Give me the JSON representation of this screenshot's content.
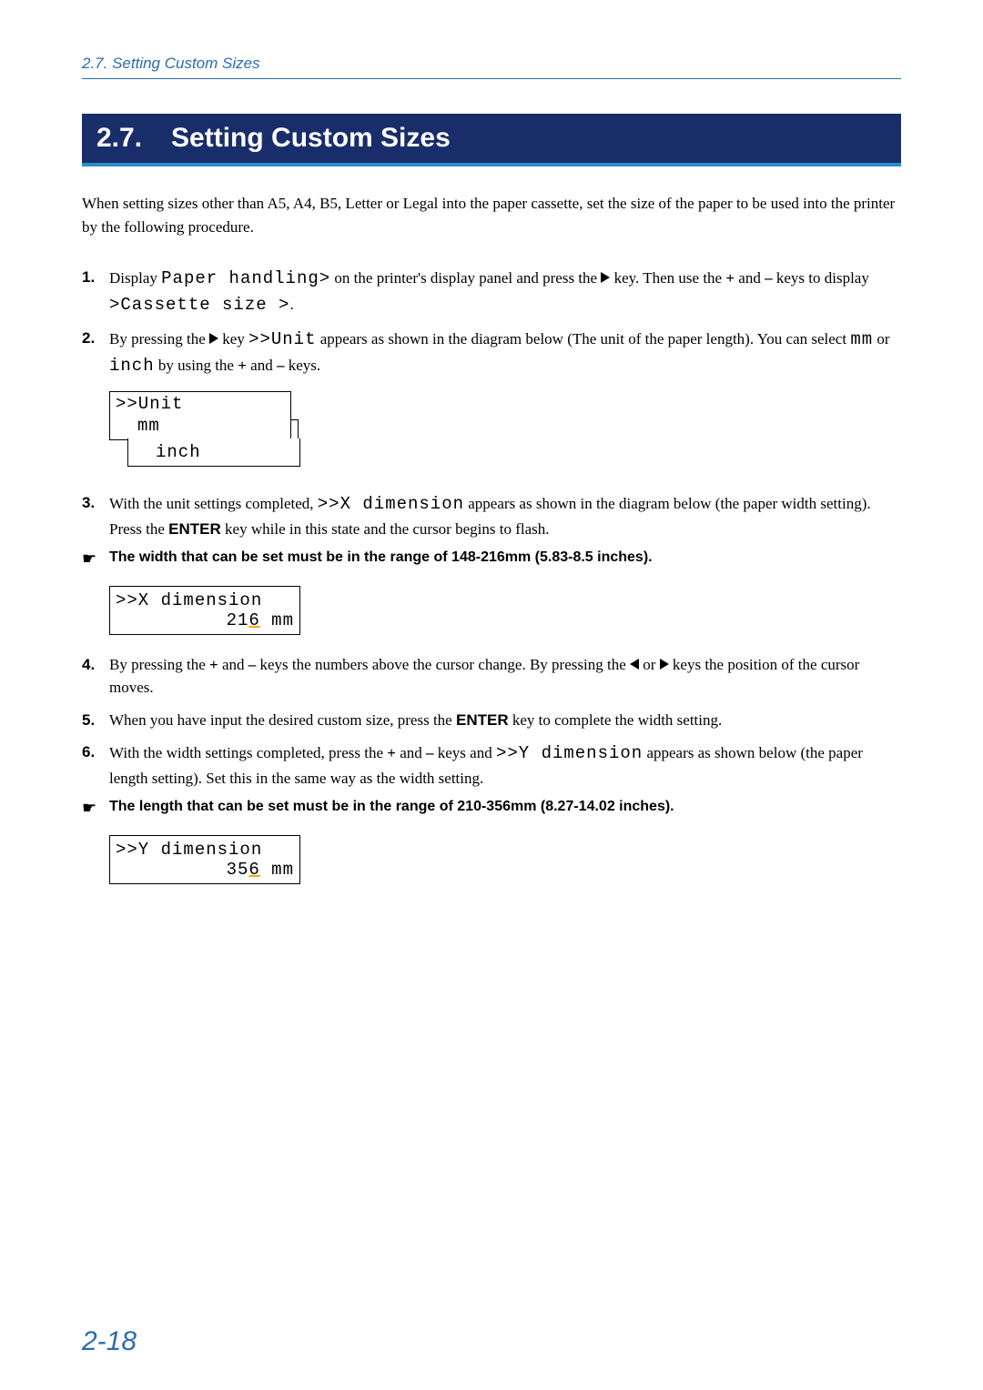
{
  "header": {
    "breadcrumb": "2.7. Setting Custom Sizes"
  },
  "title": {
    "num": "2.7.",
    "text": "Setting Custom Sizes"
  },
  "intro": "When setting sizes other than A5, A4, B5, Letter or Legal into the paper cassette, set the size of the paper to be used into the printer by the following procedure.",
  "steps": {
    "s1": {
      "num": "1.",
      "pre": "Display ",
      "lcd1": "Paper handling>",
      "mid": " on the printer's display panel and press the ",
      "mid2": " key. Then use the ",
      "plus": "+",
      "and1": " and ",
      "minus": "–",
      "post": " keys to display ",
      "lcd2": ">Cassette size >",
      "end": "."
    },
    "s2": {
      "num": "2.",
      "pre": "By pressing the ",
      "mid": " key ",
      "lcd1": ">>Unit",
      "mid2": " appears as shown in the diagram below (The unit of the paper length). You can select ",
      "lcd2": "mm",
      "or": " or ",
      "lcd3": "inch",
      "post": " by using the ",
      "plus": "+",
      "and1": " and ",
      "minus": "–",
      "end": " keys."
    },
    "s3": {
      "num": "3.",
      "pre": "With the unit settings completed, ",
      "lcd1": ">>X dimension",
      "mid": " appears as shown in the diagram below (the paper width setting).  Press the ",
      "enter": "ENTER",
      "end": " key while in this state and the cursor begins to flash."
    },
    "s4": {
      "num": "4.",
      "pre": "By pressing the ",
      "plus": "+",
      "and1": " and ",
      "minus": "–",
      "mid": " keys the numbers above the cursor change. By pressing the ",
      "or": " or ",
      "end": " keys the position of the cursor moves."
    },
    "s5": {
      "num": "5.",
      "pre": "When you have input the desired custom size, press the ",
      "enter": "ENTER",
      "end": " key to complete the width setting."
    },
    "s6": {
      "num": "6.",
      "pre": "With the width settings completed,  press the ",
      "plus": "+",
      "and1": " and ",
      "minus": "–",
      "mid": " keys and ",
      "lcd1": ">>Y dimension",
      "end": " appears as shown below (the paper length setting). Set this in the same way as the width setting."
    }
  },
  "notes": {
    "n1": "The width that can be set must be in the range of 148-216mm (5.83-8.5 inches).",
    "n2": "The length that can be set must be in the range of 210-356mm (8.27-14.02 inches)."
  },
  "displays": {
    "unit": {
      "line1": ">>Unit",
      "line2": "mm",
      "line3": "inch"
    },
    "x": {
      "line1": ">>X dimension",
      "val_pre": "21",
      "cursor": "6",
      "unit": " mm"
    },
    "y": {
      "line1": ">>Y dimension",
      "val_pre": "35",
      "cursor": "6",
      "unit": " mm"
    }
  },
  "icons": {
    "hand": "☛"
  },
  "page_number": "2-18"
}
